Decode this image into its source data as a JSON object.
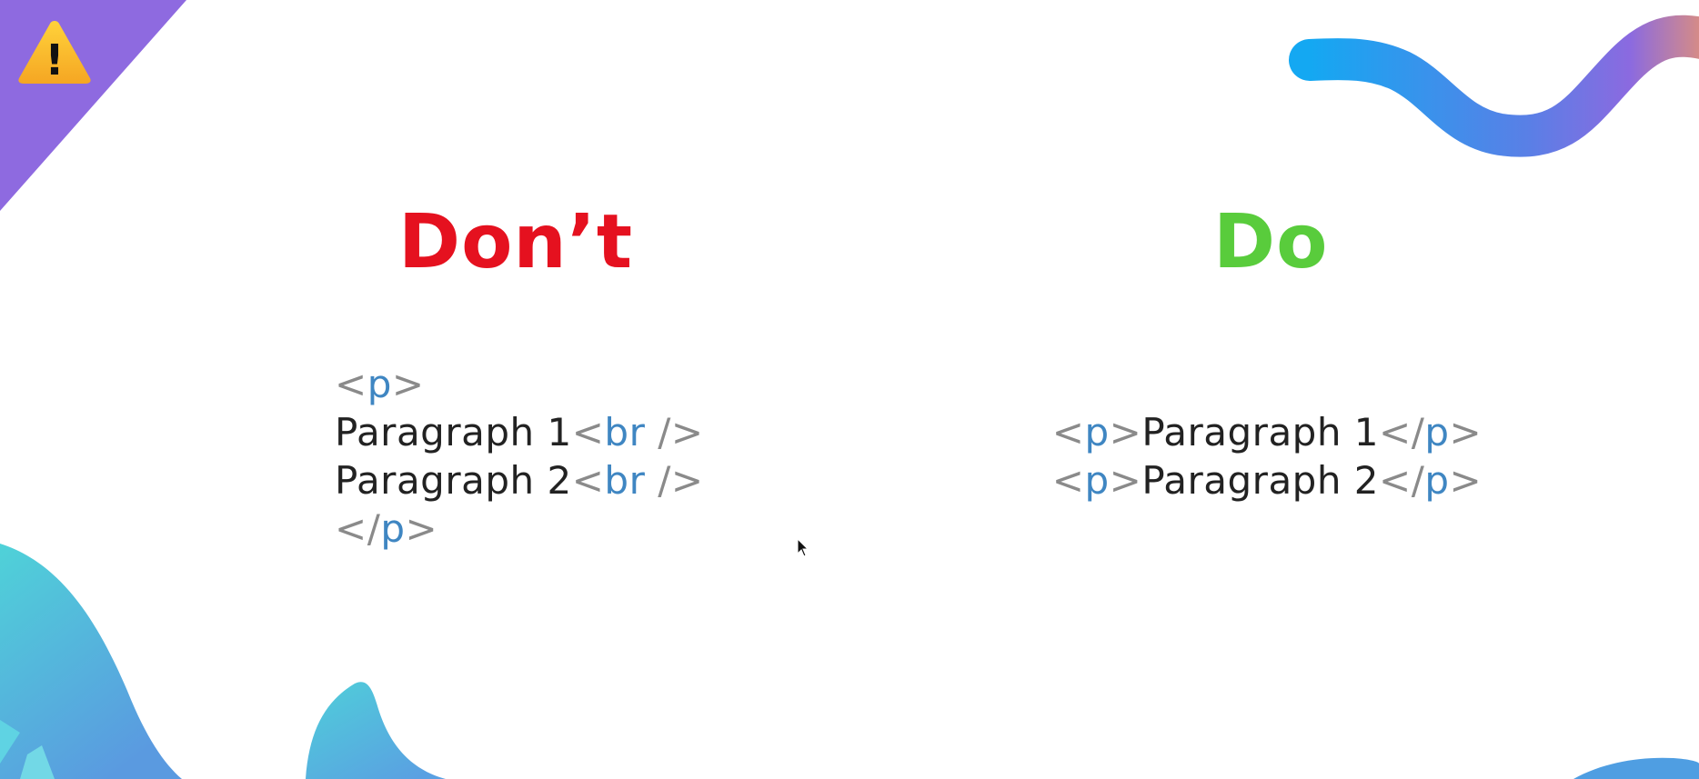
{
  "slide": {
    "dont_heading": "Don’t",
    "do_heading": "Do",
    "warning_glyph": "!"
  },
  "dont_code": {
    "open_p": {
      "lt": "<",
      "tag": "p",
      "gt": ">"
    },
    "line1": {
      "text": "Paragraph 1",
      "lt": "<",
      "tag": "br",
      "rest": " />"
    },
    "line2": {
      "text": "Paragraph 2",
      "lt": "<",
      "tag": "br",
      "rest": " />"
    },
    "close_p": {
      "lt": "</",
      "tag": "p",
      "gt": ">"
    }
  },
  "do_code": {
    "line1": {
      "lt1": "<",
      "tag1": "p",
      "gt1": ">",
      "text": "Paragraph 1",
      "lt2": "</",
      "tag2": "p",
      "gt2": ">"
    },
    "line2": {
      "lt1": "<",
      "tag1": "p",
      "gt1": ">",
      "text": "Paragraph 2",
      "lt2": "</",
      "tag2": "p",
      "gt2": ">"
    }
  },
  "colors": {
    "dont": "#e5111f",
    "do": "#59cc3c",
    "tag": "#3f86c2",
    "punct": "#8a8a8a",
    "text": "#222222",
    "purple": "#8e6ae0",
    "cyan": "#4fcfd9",
    "blue": "#1aa6f0"
  },
  "icons": {
    "warning": "warning-icon",
    "cursor": "mouse-cursor-icon"
  }
}
